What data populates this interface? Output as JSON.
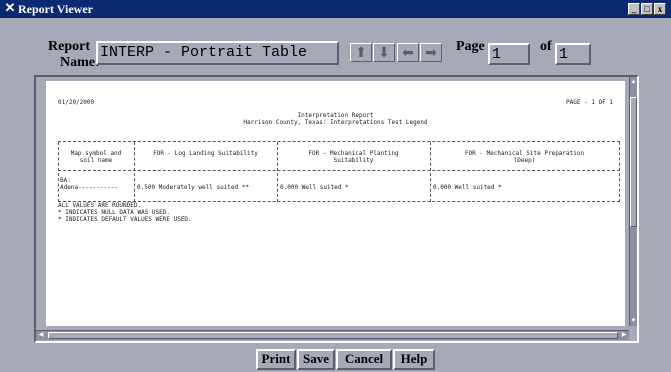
{
  "window": {
    "title": "Report Viewer"
  },
  "header": {
    "report_name_label_1": "Report",
    "report_name_label_2": "Name:",
    "report_name_value": "INTERP - Portrait Table",
    "page_label": "Page",
    "page_value": "1",
    "of_label": "of",
    "of_value": "1"
  },
  "report": {
    "date": "01/20/2000",
    "page_info": "PAGE -   1 OF   1",
    "title": "Interpretation Report",
    "subtitle": "Harrison County, Texas: Interpretations Test Legend",
    "columns": [
      {
        "line1": "Map symbol and",
        "line2": "soil name"
      },
      {
        "line1": "FOR - Log Landing Suitability",
        "line2": ""
      },
      {
        "line1": "FOR - Mechanical Planting",
        "line2": "Suitability"
      },
      {
        "line1": "FOR - Mechanical Site Preparation",
        "line2": "(Deep)"
      }
    ],
    "row": {
      "symbol": "BA:",
      "soil": "Adena-----------",
      "col1": "0.500 Moderately well suited **",
      "col2": "0.000 Well suited *",
      "col3": "0.000 Well suited *"
    },
    "notes": [
      "ALL VALUES ARE ROUNDED.",
      "* INDICATES NULL DATA WAS USED.",
      "* INDICATES DEFAULT VALUES WERE USED."
    ]
  },
  "buttons": {
    "print": "Print",
    "save": "Save",
    "cancel": "Cancel",
    "help": "Help"
  },
  "colors": {
    "titlebar": "#0a2b72",
    "window_bg": "#a7a9b9",
    "paper": "#ffffff"
  }
}
